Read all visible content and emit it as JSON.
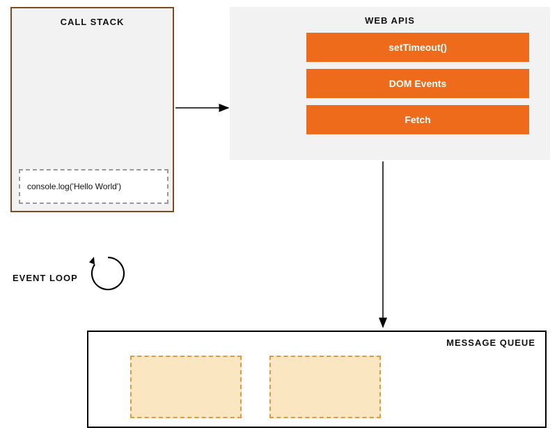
{
  "call_stack": {
    "title": "CALL STACK",
    "frames": [
      "console.log('Hello World')"
    ]
  },
  "web_apis": {
    "title": "WEB APIS",
    "items": [
      "setTimeout()",
      "DOM Events",
      "Fetch"
    ]
  },
  "event_loop": {
    "label": "EVENT LOOP"
  },
  "message_queue": {
    "title": "MESSAGE QUEUE",
    "slot_count": 2
  },
  "colors": {
    "api_item_bg": "#ed6b1a",
    "queue_slot_bg": "#fbe6c2",
    "queue_slot_border": "#e29a3f",
    "call_stack_border": "#7a4b1e"
  }
}
